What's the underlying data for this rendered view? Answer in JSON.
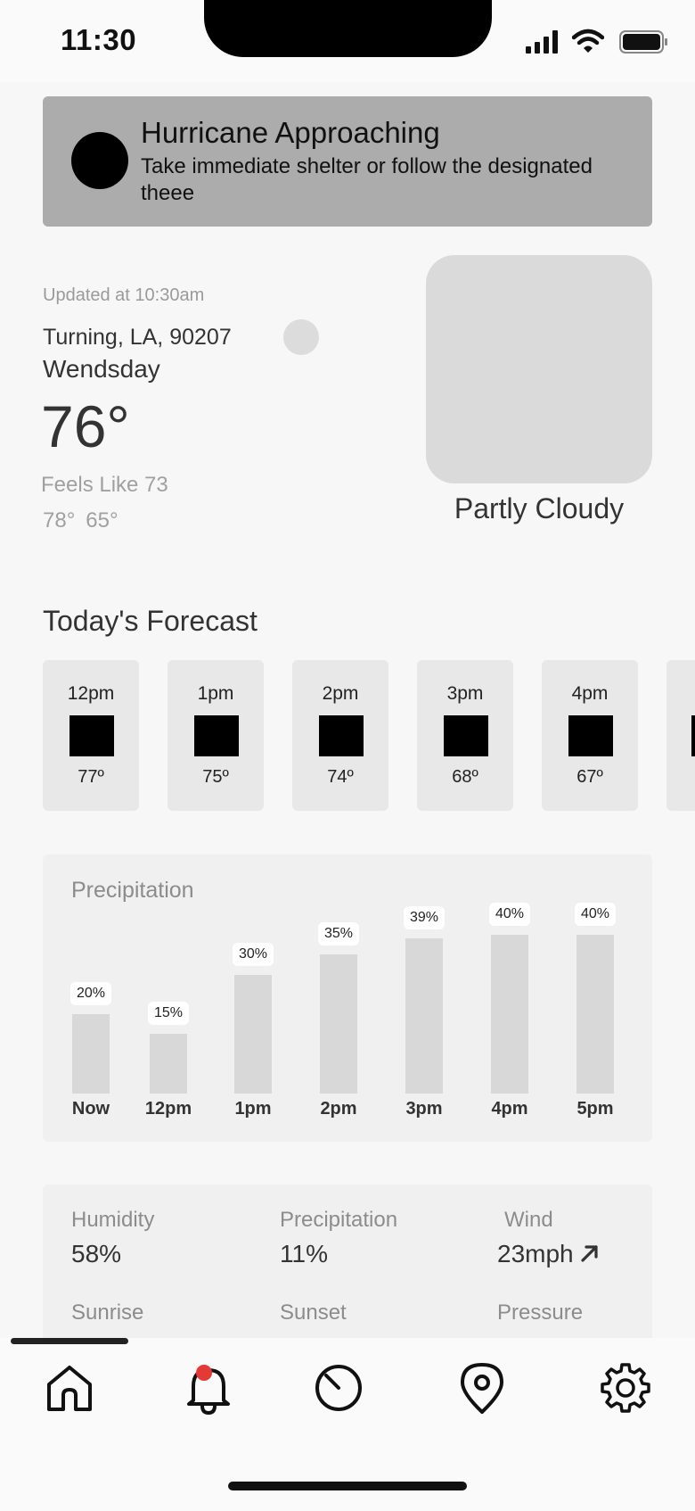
{
  "status_bar": {
    "time": "11:30"
  },
  "alert": {
    "title": "Hurricane Approaching",
    "body": "Take immediate shelter or follow the designated theee"
  },
  "current": {
    "updated": "Updated at 10:30am",
    "location": "Turning, LA, 90207",
    "day": "Wendsday",
    "temperature": "76°",
    "feels_like": "Feels Like 73",
    "high": "78°",
    "low": "65°",
    "condition": "Partly Cloudy"
  },
  "forecast": {
    "title": "Today's Forecast",
    "hours": [
      {
        "time": "12pm",
        "temp": "77º"
      },
      {
        "time": "1pm",
        "temp": "75º"
      },
      {
        "time": "2pm",
        "temp": "74º"
      },
      {
        "time": "3pm",
        "temp": "68º"
      },
      {
        "time": "4pm",
        "temp": "67º"
      }
    ]
  },
  "precipitation": {
    "title": "Precipitation"
  },
  "chart_data": {
    "type": "bar",
    "categories": [
      "Now",
      "12pm",
      "1pm",
      "2pm",
      "3pm",
      "4pm",
      "5pm"
    ],
    "values": [
      20,
      15,
      30,
      35,
      39,
      40,
      40
    ],
    "labels": [
      "20%",
      "15%",
      "30%",
      "35%",
      "39%",
      "40%",
      "40%"
    ],
    "ylim": [
      0,
      50
    ]
  },
  "details": {
    "humidity_label": "Humidity",
    "humidity_value": "58%",
    "precip_label": "Precipitation",
    "precip_value": "11%",
    "wind_label": "Wind",
    "wind_value": "23mph",
    "sunrise_label": "Sunrise",
    "sunset_label": "Sunset",
    "pressure_label": "Pressure"
  },
  "nav": {
    "items": [
      "home-icon",
      "bell-icon",
      "clock-icon",
      "location-pin-icon",
      "gear-icon"
    ],
    "badge_color": "#e53935"
  }
}
